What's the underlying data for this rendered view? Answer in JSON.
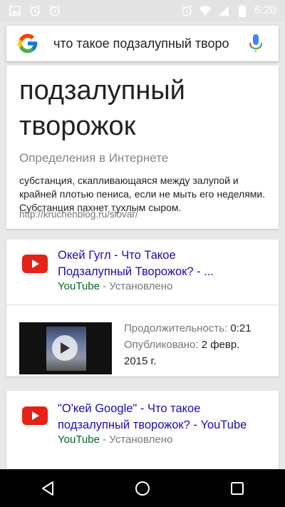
{
  "status_bar": {
    "time": "6:20",
    "left_icons": [
      "image-icon",
      "alarm-icon",
      "alarm-icon"
    ],
    "right_icons": [
      "alarm-icon",
      "wifi-icon",
      "signal-icon",
      "battery-icon"
    ]
  },
  "search": {
    "query": "что такое подзалупный творо",
    "left_icon": "google-g-icon",
    "right_icon": "microphone-icon"
  },
  "definition": {
    "word_line1": "подзалупный",
    "word_line2": "творожок",
    "source_title": "Определения в Интернете",
    "text": "субстанция, скапливающаяся между залупой и крайней плотью пениса, если не мыть его неделями. Субстанция пахнет тухлым сыром.",
    "url": "http://kruchenblog.ru/slovar/"
  },
  "results": [
    {
      "title_line1": "Окей Гугл - Что Такое",
      "title_line2": "Подзалупный Творожок? - ...",
      "source": "YouTube",
      "separator": " - ",
      "status": "Установлено",
      "duration_label": "Продолжительность:",
      "duration_value": "0:21",
      "published_label": "Опубликовано:",
      "published_value_line1": "2 февр.",
      "published_value_line2": "2015 г."
    },
    {
      "title_line1": "\"О'кей Google\" - Что такое",
      "title_line2": "подзалупный творожок? - YouTube",
      "source": "YouTube",
      "separator": " - ",
      "status": "Установлено"
    }
  ],
  "colors": {
    "link": "#1a0dab",
    "source_green": "#006621",
    "youtube_red": "#e62117",
    "gray_text": "#777777"
  }
}
